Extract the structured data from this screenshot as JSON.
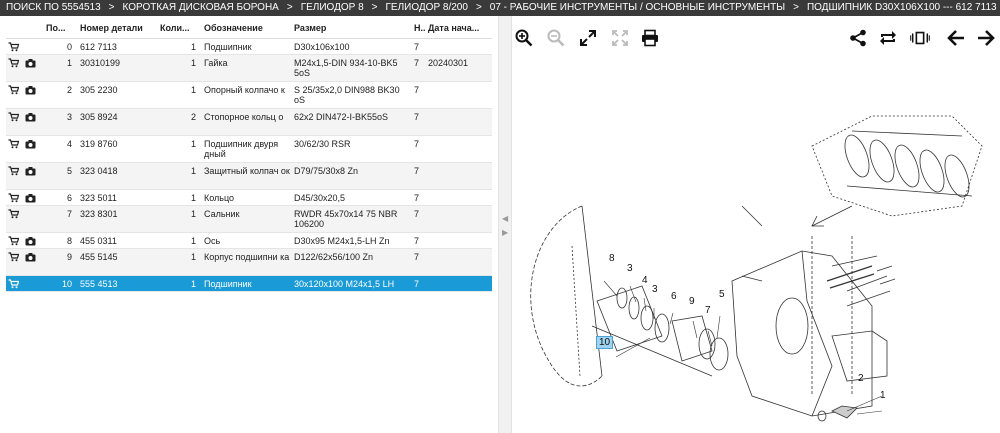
{
  "breadcrumb": [
    "ПОИСК ПО 5554513",
    "КОРОТКАЯ ДИСКОВАЯ БОРОНА",
    "ГЕЛИОДОР 8",
    "ГЕЛИОДОР 8/200",
    "07 - РАБОЧИЕ ИНСТРУМЕНТЫ / ОСНОВНЫЕ ИНСТРУМЕНТЫ",
    "ПОДШИПНИК D30X106X100 --- 612 7113"
  ],
  "breadcrumb_separator": ">",
  "table": {
    "headers": [
      "По...",
      "Номер детали",
      "Коли...",
      "Обозначение",
      "Размер",
      "Н...",
      "Дата нача..."
    ],
    "rows": [
      {
        "pos": "0",
        "part": "612 7113",
        "qty": "1",
        "name": "Подшипник",
        "size": "D30x106x100",
        "n": "7",
        "date": "",
        "camera": false,
        "selected": false
      },
      {
        "pos": "1",
        "part": "30310199",
        "qty": "1",
        "name": "Гайка",
        "size": "M24x1,5-DIN 934-10-BK5 5oS",
        "n": "7",
        "date": "20240301",
        "camera": true,
        "selected": false
      },
      {
        "pos": "2",
        "part": "305 2230",
        "qty": "1",
        "name": "Опорный колпачо к",
        "size": "S 25/35x2,0 DIN988 BK30 oS",
        "n": "7",
        "date": "",
        "camera": true,
        "selected": false
      },
      {
        "pos": "3",
        "part": "305 8924",
        "qty": "2",
        "name": "Стопорное кольц о",
        "size": "62x2 DIN472-I-BK55oS",
        "n": "7",
        "date": "",
        "camera": true,
        "selected": false
      },
      {
        "pos": "4",
        "part": "319 8760",
        "qty": "1",
        "name": "Подшипник двуря дный",
        "size": "30/62/30 RSR",
        "n": "7",
        "date": "",
        "camera": true,
        "selected": false
      },
      {
        "pos": "5",
        "part": "323 0418",
        "qty": "1",
        "name": "Защитный колпач ок",
        "size": "D79/75/30x8 Zn",
        "n": "7",
        "date": "",
        "camera": true,
        "selected": false
      },
      {
        "pos": "6",
        "part": "323 5011",
        "qty": "1",
        "name": "Кольцо",
        "size": "D45/30x20,5",
        "n": "7",
        "date": "",
        "camera": true,
        "selected": false
      },
      {
        "pos": "7",
        "part": "323 8301",
        "qty": "1",
        "name": "Сальник",
        "size": "RWDR 45x70x14 75 NBR 106200",
        "n": "7",
        "date": "",
        "camera": false,
        "selected": false
      },
      {
        "pos": "8",
        "part": "455 0311",
        "qty": "1",
        "name": "Ось",
        "size": "D30x95 M24x1,5-LH Zn",
        "n": "7",
        "date": "",
        "camera": true,
        "selected": false
      },
      {
        "pos": "9",
        "part": "455 5145",
        "qty": "1",
        "name": "Корпус подшипни ка",
        "size": "D122/62x56/100 Zn",
        "n": "7",
        "date": "",
        "camera": true,
        "selected": false
      },
      {
        "pos": "10",
        "part": "555 4513",
        "qty": "1",
        "name": "Подшипник",
        "size": "30x120x100 M24x1,5 LH",
        "n": "7",
        "date": "",
        "camera": false,
        "selected": true
      }
    ]
  },
  "toolbar": {
    "left": [
      "zoom-in-icon",
      "zoom-out-icon",
      "expand-icon",
      "fit-icon",
      "print-icon"
    ],
    "right": [
      "share-icon",
      "repeat-icon",
      "flip-icon",
      "arrow-left-icon",
      "arrow-right-icon"
    ]
  },
  "diagram": {
    "callouts": [
      "8",
      "3",
      "4",
      "3",
      "6",
      "5",
      "9",
      "7",
      "10",
      "2",
      "1"
    ],
    "selected_callout": "10"
  },
  "colors": {
    "breadcrumb_bg": "#3a3a3a",
    "selected_row": "#1a9ad6",
    "callout_highlight": "#9fd3ef"
  }
}
